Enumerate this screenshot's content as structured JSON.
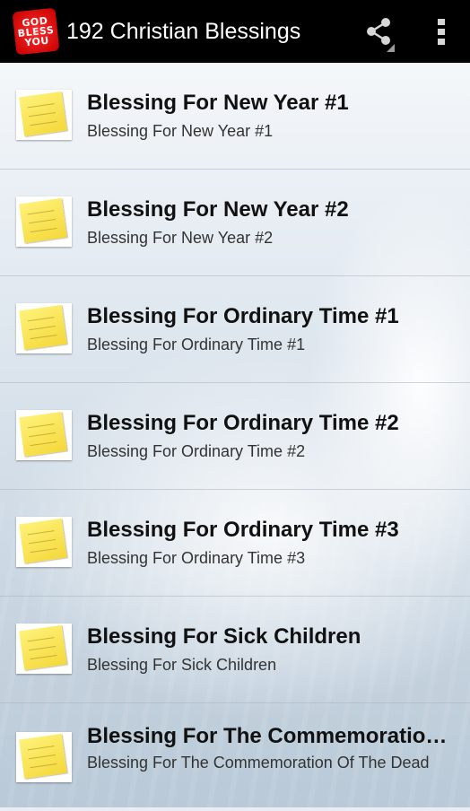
{
  "app": {
    "icon_text": [
      "GOD",
      "BLESS",
      "YOU"
    ],
    "title": "192 Christian Blessings"
  },
  "actions": {
    "share_icon": "share-icon",
    "overflow_icon": "overflow-menu-icon"
  },
  "list": {
    "thumbnail": "god-bless-you-note",
    "items": [
      {
        "title": "Blessing For New Year #1",
        "subtitle": "Blessing For New Year #1"
      },
      {
        "title": "Blessing For New Year #2",
        "subtitle": "Blessing For New Year #2"
      },
      {
        "title": "Blessing For Ordinary Time #1",
        "subtitle": "Blessing For Ordinary Time #1"
      },
      {
        "title": "Blessing For Ordinary Time #2",
        "subtitle": "Blessing For Ordinary Time #2"
      },
      {
        "title": "Blessing For Ordinary Time #3",
        "subtitle": "Blessing For Ordinary Time #3"
      },
      {
        "title": "Blessing For Sick Children",
        "subtitle": "Blessing For Sick Children"
      },
      {
        "title": "Blessing For The Commemoration Of The Dead",
        "subtitle": "Blessing For The Commemoration Of The Dead"
      }
    ]
  }
}
